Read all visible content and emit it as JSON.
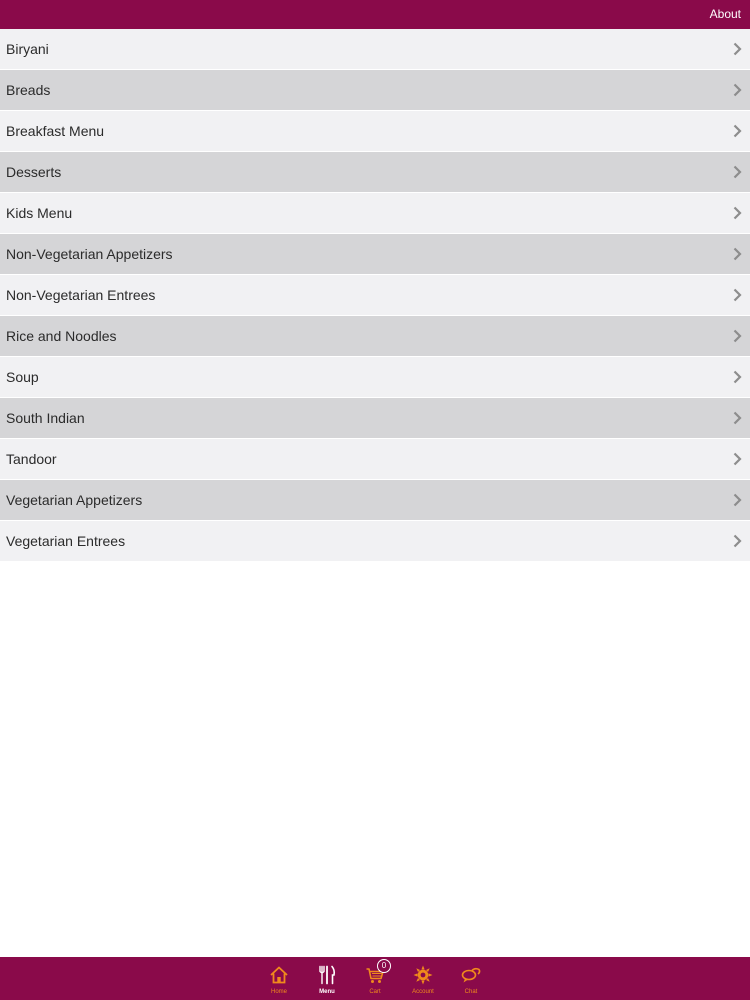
{
  "header": {
    "about_label": "About"
  },
  "menu": {
    "items": [
      {
        "label": "Biryani"
      },
      {
        "label": "Breads"
      },
      {
        "label": "Breakfast Menu"
      },
      {
        "label": "Desserts"
      },
      {
        "label": "Kids Menu"
      },
      {
        "label": "Non-Vegetarian Appetizers"
      },
      {
        "label": "Non-Vegetarian Entrees"
      },
      {
        "label": "Rice and Noodles"
      },
      {
        "label": "Soup"
      },
      {
        "label": "South Indian"
      },
      {
        "label": "Tandoor"
      },
      {
        "label": "Vegetarian Appetizers"
      },
      {
        "label": "Vegetarian Entrees"
      }
    ]
  },
  "tabbar": {
    "tabs": [
      {
        "label": "Home",
        "icon": "home-icon"
      },
      {
        "label": "Menu",
        "icon": "fork-knife-icon",
        "active": true
      },
      {
        "label": "Cart",
        "icon": "cart-icon",
        "badge": "0"
      },
      {
        "label": "Account",
        "icon": "sun-account-icon"
      },
      {
        "label": "Chat",
        "icon": "chat-icon"
      }
    ]
  },
  "colors": {
    "brand": "#8a0a4a",
    "accent": "#f08a1c",
    "row_light": "#f1f1f3",
    "row_dark": "#d5d5d7"
  }
}
